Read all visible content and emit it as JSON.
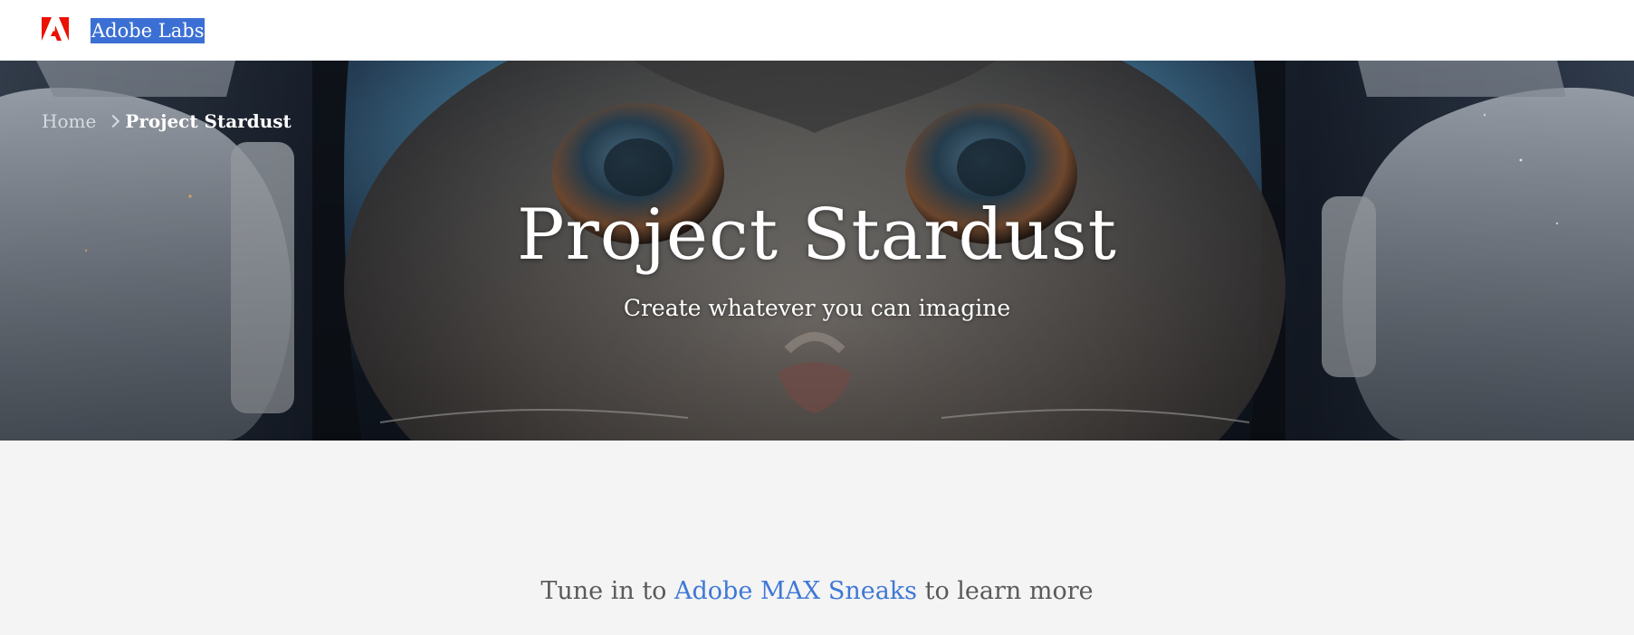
{
  "header": {
    "logo_icon": "adobe-logo-icon",
    "brand_label": "Adobe Labs",
    "brand_color": "#3b6fd4",
    "logo_color": "#eb1000"
  },
  "breadcrumb": {
    "home_label": "Home",
    "separator_icon": "chevron-right-icon",
    "current_label": "Project Stardust"
  },
  "hero": {
    "title": "Project Stardust",
    "subtitle": "Create whatever you can imagine",
    "image": "astronaut-cat-helmet-image"
  },
  "cta": {
    "prefix": "Tune in to ",
    "link_label": "Adobe MAX Sneaks",
    "suffix": " to learn more",
    "link_color": "#3f78d6"
  }
}
